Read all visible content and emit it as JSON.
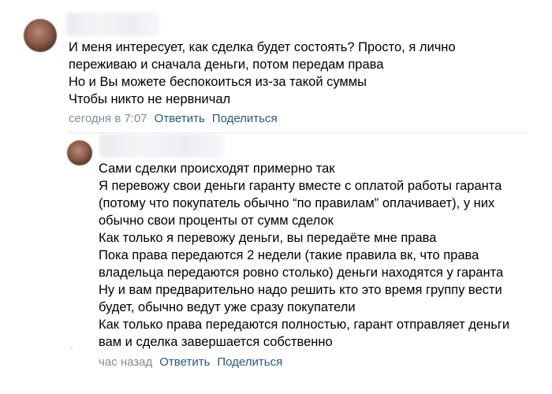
{
  "comments": [
    {
      "author": "",
      "lines": [
        "И меня интересует, как сделка будет состоять? Просто, я лично",
        "переживаю и сначала деньги, потом передам права",
        "Но и Вы можете беспокоиться из-за такой суммы",
        "Чтобы никто не нервничал"
      ],
      "time": "сегодня в 7:07",
      "reply_label": "Ответить",
      "share_label": "Поделиться"
    },
    {
      "author": "",
      "lines": [
        "Сами сделки происходят примерно так",
        "Я перевожу свои деньги гаранту вместе с оплатой работы гаранта",
        "(потому что покупатель обычно “по правилам” оплачивает), у них",
        "обычно свои проценты от сумм сделок",
        "Как только я перевожу деньги, вы передаёте мне права",
        "Пока права передаются 2 недели (такие правила вк, что права",
        "владельца передаются ровно столько) деньги находятся у гаранта",
        "Ну и вам предварительно надо решить кто это время группу вести",
        "будет, обычно ведут уже сразу покупатели",
        "Как только права передаются полностью, гарант отправляет деньги",
        "вам и сделка завершается собственно"
      ],
      "time": "час назад",
      "reply_label": "Ответить",
      "share_label": "Поделиться"
    }
  ]
}
